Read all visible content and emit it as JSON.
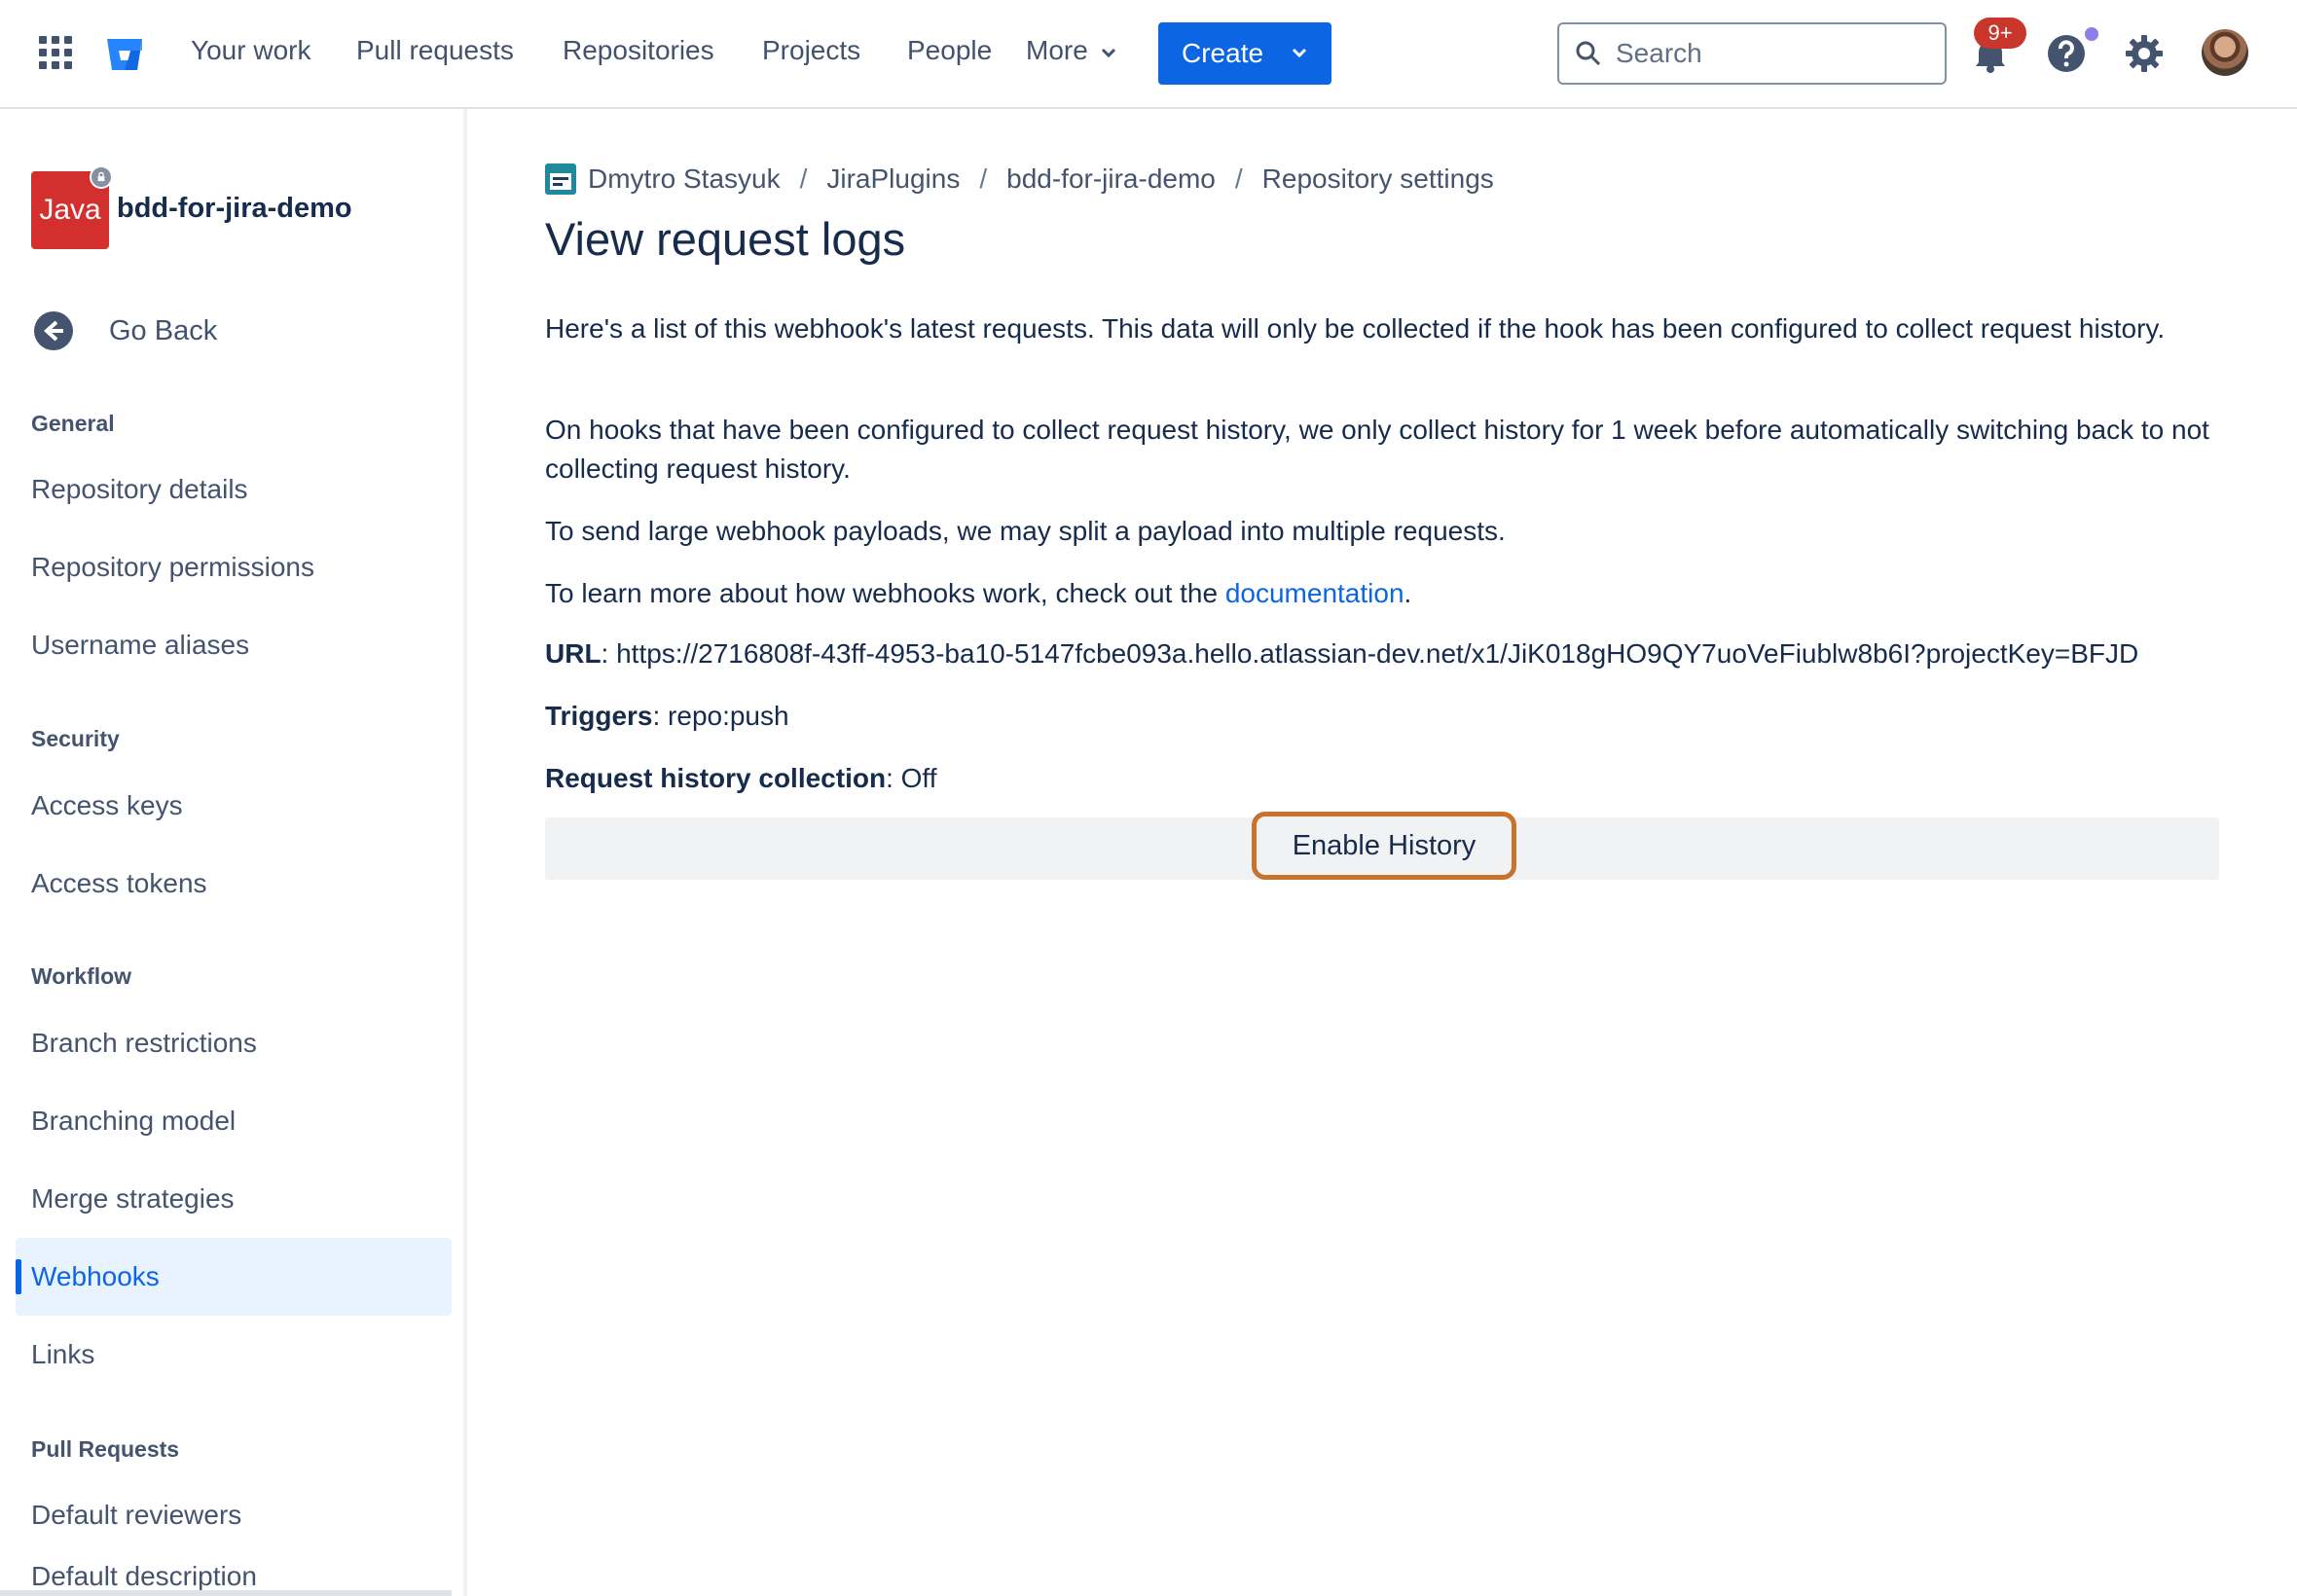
{
  "topnav": {
    "items": [
      "Your work",
      "Pull requests",
      "Repositories",
      "Projects",
      "People",
      "More"
    ],
    "create_label": "Create",
    "search_placeholder": "Search",
    "notification_count": "9+",
    "accent": "#0c66e4"
  },
  "sidebar": {
    "repo_avatar_text": "Java",
    "repo_name": "bdd-for-jira-demo",
    "go_back": "Go Back",
    "sections": {
      "general": "General",
      "security": "Security",
      "workflow": "Workflow",
      "pull_requests": "Pull Requests"
    },
    "items": {
      "repository_details": "Repository details",
      "repository_permissions": "Repository permissions",
      "username_aliases": "Username aliases",
      "access_keys": "Access keys",
      "access_tokens": "Access tokens",
      "branch_restrictions": "Branch restrictions",
      "branching_model": "Branching model",
      "merge_strategies": "Merge strategies",
      "webhooks": "Webhooks",
      "links": "Links",
      "default_reviewers": "Default reviewers",
      "default_description": "Default description"
    }
  },
  "breadcrumb": [
    "Dmytro Stasyuk",
    "JiraPlugins",
    "bdd-for-jira-demo",
    "Repository settings"
  ],
  "page": {
    "title": "View request logs",
    "para1": "Here's a list of this webhook's latest requests. This data will only be collected if the hook has been configured to collect request history.",
    "para2": "On hooks that have been configured to collect request history, we only collect history for 1 week before automatically switching back to not collecting request history.",
    "para3": "To send large webhook payloads, we may split a payload into multiple requests.",
    "para4_prefix": "To learn more about how webhooks work, check out the ",
    "para4_link": "documentation",
    "para4_suffix": ".",
    "url_label": "URL",
    "url_value": ": https://2716808f-43ff-4953-ba10-5147fcbe093a.hello.atlassian-dev.net/x1/JiK018gHO9QY7uoVeFiublw8b6I?projectKey=BFJD",
    "triggers_label": "Triggers",
    "triggers_value": ": repo:push",
    "history_label": "Request history collection",
    "history_value": ": Off",
    "enable_button": "Enable History"
  }
}
